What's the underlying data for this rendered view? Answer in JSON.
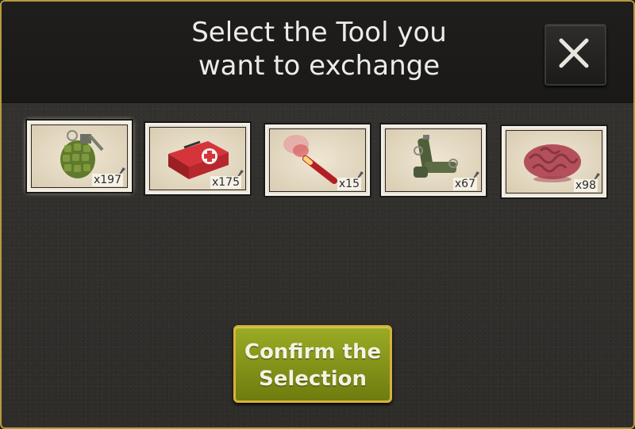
{
  "dialog": {
    "title": "Select the Tool you\nwant to exchange",
    "close_icon": "close-icon",
    "confirm_label": "Confirm the\nSelection"
  },
  "tools": [
    {
      "name": "frag-grenade",
      "icon": "frag-grenade-icon",
      "count": "x197",
      "selected": true
    },
    {
      "name": "first-aid-kit",
      "icon": "first-aid-kit-icon",
      "count": "x175",
      "selected": false
    },
    {
      "name": "flare",
      "icon": "flare-icon",
      "count": "x15",
      "selected": false
    },
    {
      "name": "stun-grenades",
      "icon": "stun-grenades-icon",
      "count": "x67",
      "selected": false
    },
    {
      "name": "brain",
      "icon": "brain-icon",
      "count": "x98",
      "selected": false
    }
  ],
  "colors": {
    "frame_gold": "#b59a3c",
    "button_green": "#8a9a1c",
    "button_border": "#d6b23a"
  }
}
